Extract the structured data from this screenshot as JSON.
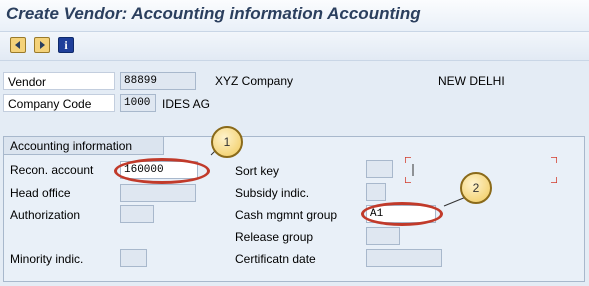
{
  "window": {
    "title": "Create Vendor: Accounting information Accounting"
  },
  "toolbar": {
    "buttons": [
      {
        "name": "previous-screen",
        "icon": "page-previous-icon"
      },
      {
        "name": "next-screen",
        "icon": "page-next-icon"
      },
      {
        "name": "info",
        "icon": "info-icon",
        "glyph": "i"
      }
    ]
  },
  "header": {
    "vendor_label": "Vendor",
    "vendor_value": "88899",
    "vendor_name": "XYZ Company",
    "vendor_city": "NEW DELHI",
    "company_code_label": "Company Code",
    "company_code_value": "1000",
    "company_name": "IDES AG"
  },
  "group": {
    "title": "Accounting information",
    "left": {
      "recon_label": "Recon. account",
      "recon_value": "160000",
      "head_office_label": "Head office",
      "head_office_value": "",
      "authorization_label": "Authorization",
      "authorization_value": "",
      "minority_label": "Minority indic.",
      "minority_value": ""
    },
    "right": {
      "sort_key_label": "Sort key",
      "sort_key_value": "",
      "subsidy_label": "Subsidy indic.",
      "subsidy_value": "",
      "cash_mgmt_label": "Cash mgmnt group",
      "cash_mgmt_value": "A1",
      "release_label": "Release group",
      "release_value": "",
      "cert_date_label": "Certificatn date",
      "cert_date_value": ""
    }
  },
  "annotations": {
    "callout_1": "1",
    "callout_2": "2",
    "highlight_color": "#c13a2a"
  }
}
